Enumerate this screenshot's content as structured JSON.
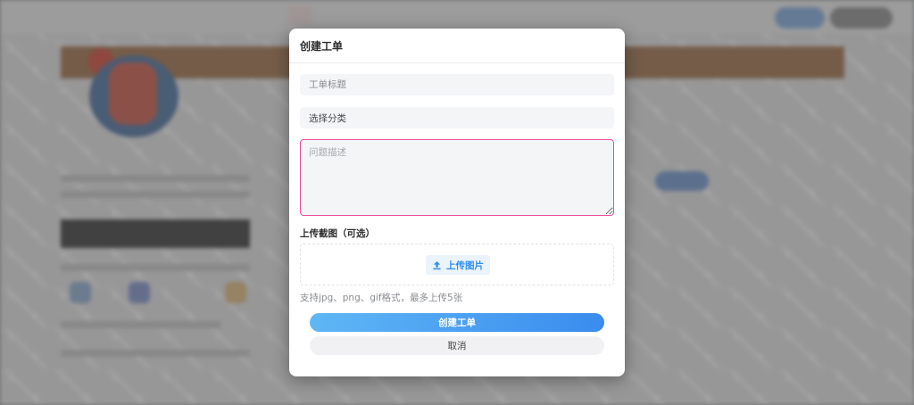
{
  "modal": {
    "title": "创建工单",
    "title_field": {
      "placeholder": "工单标题",
      "value": ""
    },
    "category_select": {
      "selected": "选择分类"
    },
    "description_field": {
      "placeholder": "问题描述",
      "value": ""
    },
    "screenshot_section": {
      "label": "上传截图（可选）",
      "upload_button_label": "上传图片",
      "upload_icon": "upload-icon",
      "hint": "支持jpg、png、gif格式，最多上传5张"
    },
    "submit_label": "创建工单",
    "cancel_label": "取消"
  },
  "colors": {
    "accent_start": "#5fb7f5",
    "accent_end": "#3a8cee",
    "upload_text": "#2f8df0",
    "focus_border": "#ea4f9a"
  }
}
